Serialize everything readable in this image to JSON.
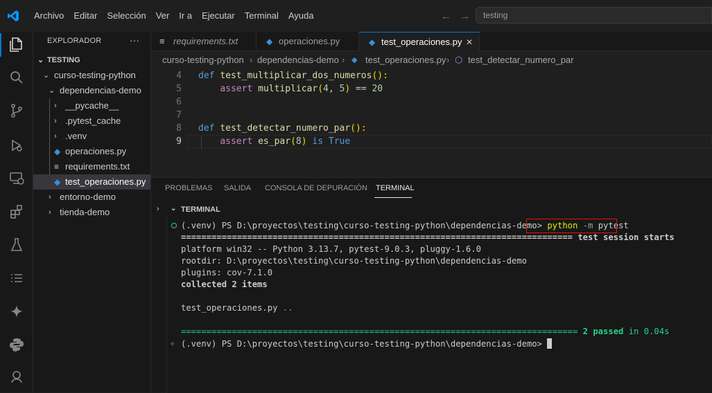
{
  "menu": [
    "Archivo",
    "Editar",
    "Selección",
    "Ver",
    "Ir a",
    "Ejecutar",
    "Terminal",
    "Ayuda"
  ],
  "search": {
    "text": "testing"
  },
  "sidebar": {
    "title": "EXPLORADOR",
    "more": "···",
    "root": "TESTING",
    "items": [
      {
        "label": "curso-testing-python",
        "kind": "folder-open"
      },
      {
        "label": "dependencias-demo",
        "kind": "folder-open"
      },
      {
        "label": "__pycache__",
        "kind": "folder"
      },
      {
        "label": ".pytest_cache",
        "kind": "folder"
      },
      {
        "label": ".venv",
        "kind": "folder"
      },
      {
        "label": "operaciones.py",
        "kind": "python"
      },
      {
        "label": "requirements.txt",
        "kind": "text"
      },
      {
        "label": "test_operaciones.py",
        "kind": "python"
      },
      {
        "label": "entorno-demo",
        "kind": "folder"
      },
      {
        "label": "tienda-demo",
        "kind": "folder"
      }
    ]
  },
  "tabs": [
    {
      "label": "requirements.txt"
    },
    {
      "label": "operaciones.py"
    },
    {
      "label": "test_operaciones.py",
      "close": "✕"
    }
  ],
  "breadcrumb": [
    "curso-testing-python",
    "dependencias-demo",
    "test_operaciones.py",
    "test_detectar_numero_par"
  ],
  "code": {
    "line_numbers": [
      "4",
      "5",
      "6",
      "7",
      "8",
      "9"
    ],
    "l4_def": "def",
    "l4_name": "test_multiplicar_dos_numeros",
    "l4_tail": "():",
    "l5_assert": "assert",
    "l5_fn": "multiplicar",
    "l5_a": "4",
    "l5_sep": ", ",
    "l5_b": "5",
    "l5_eq": " == ",
    "l5_res": "20",
    "l8_def": "def",
    "l8_name": "test_detectar_numero_par",
    "l8_tail": "():",
    "l9_assert": "assert",
    "l9_fn": "es_par",
    "l9_arg": "8",
    "l9_is": "is",
    "l9_true": "True"
  },
  "panel": {
    "tabs": [
      "PROBLEMAS",
      "SALIDA",
      "CONSOLA DE DEPURACIÓN",
      "TERMINAL"
    ],
    "terminal_title": "TERMINAL"
  },
  "terminal": {
    "prompt": "(.venv) PS D:\\proyectos\\testing\\curso-testing-python\\dependencias-demo>",
    "command_exe": "python",
    "command_flag": "-m",
    "command_arg": "pytest",
    "session_rule": "============================================================================= ",
    "session_text": "test session starts",
    "platform": "platform win32 -- Python 3.13.7, pytest-9.0.3, pluggy-1.6.0",
    "rootdir": "rootdir: D:\\proyectos\\testing\\curso-testing-python\\dependencias-demo",
    "plugins": "plugins: cov-7.1.0",
    "collected": "collected 2 items",
    "test_file": "test_operaciones.py",
    "test_dots": "..",
    "summary_rule": "============================================================================== ",
    "summary_passed": "2 passed",
    "summary_in": " in 0.04s"
  },
  "colors": {
    "accent": "#0078d4",
    "pass": "#23d18b",
    "highlight_box": "#e51400"
  }
}
